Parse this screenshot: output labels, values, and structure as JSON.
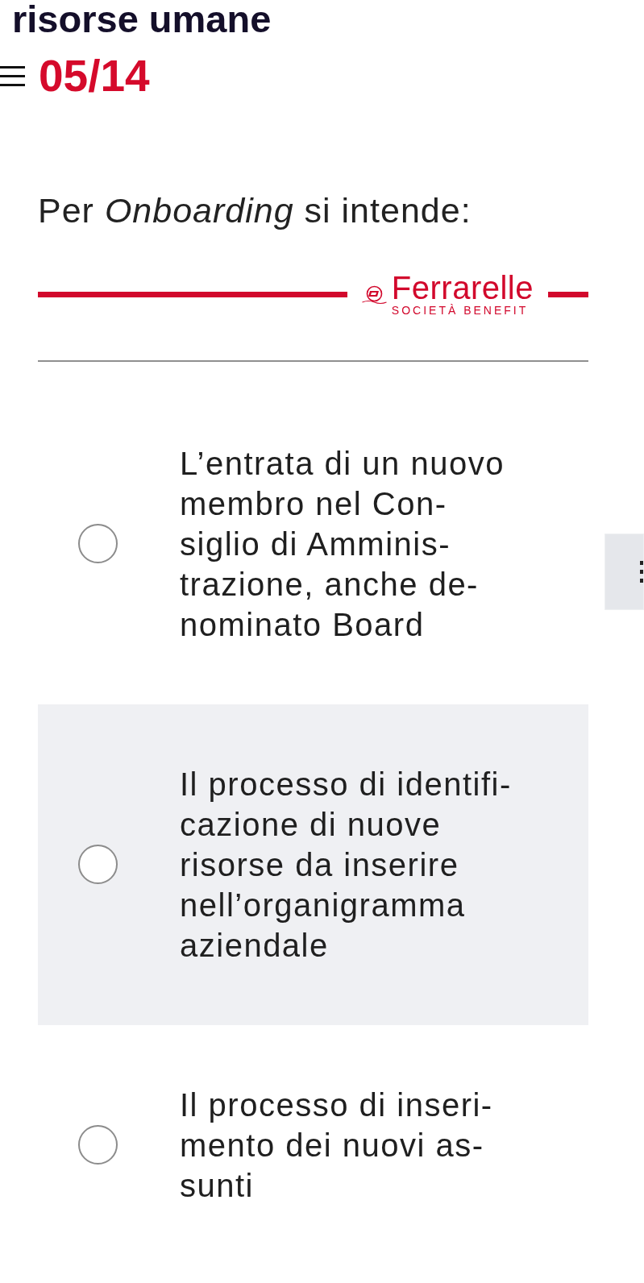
{
  "header": {
    "title": "risorse umane",
    "progress": "05/14"
  },
  "question": {
    "text": "Per *Onboarding* si intende:"
  },
  "logo": {
    "name": "Ferrarelle",
    "tagline": "SOCIETÀ BENEFIT"
  },
  "options": [
    {
      "text": "L’entrata di un nuovo\nmembro nel Con-\nsiglio di Amminis-\ntrazione, anche de-\nnominato Board",
      "selected": false,
      "highlighted": false
    },
    {
      "text": "Il processo di identifi-\ncazione di nuove\nrisorse da inserire\nnell’organigramma\naziendale",
      "selected": false,
      "highlighted": true
    },
    {
      "text": "Il processo di inseri-\nmento dei nuovi as-\nsunti",
      "selected": false,
      "highlighted": false
    }
  ]
}
